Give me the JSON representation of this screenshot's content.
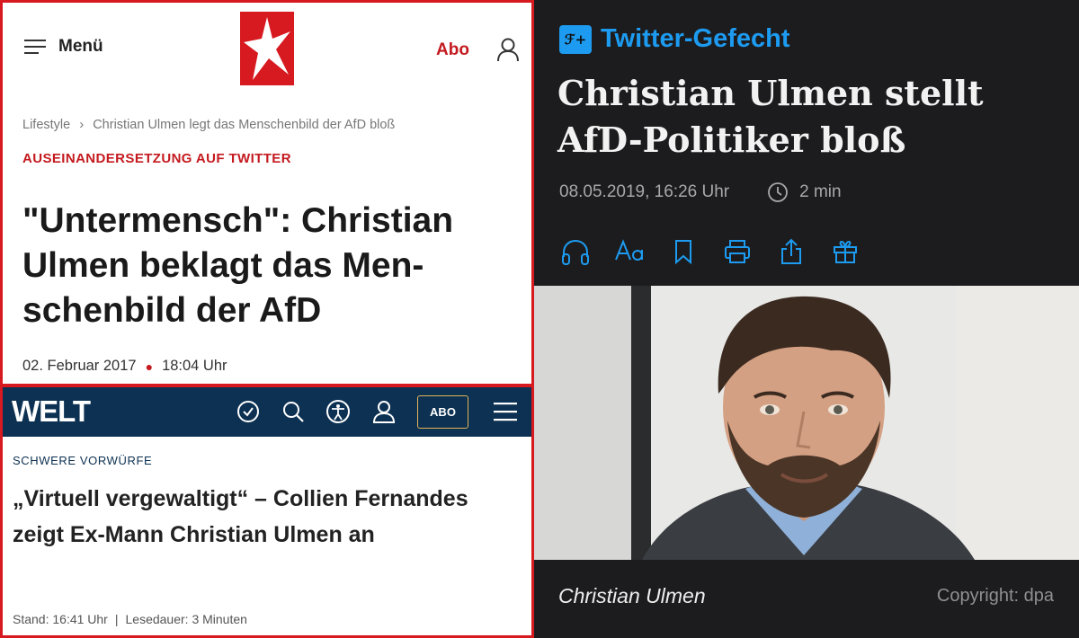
{
  "stern": {
    "menu_label": "Menü",
    "abo_label": "Abo",
    "breadcrumb": [
      "Lifestyle",
      "Christian Ulmen legt das Menschenbild der AfD bloß"
    ],
    "kicker": "AUSEINANDERSETZUNG AUF TWITTER",
    "headline": "\"Untermensch\": Christian Ulmen beklagt das Men-schenbild der AfD",
    "date": "02. Februar 2017",
    "time": "18:04 Uhr",
    "accent": "#d71920"
  },
  "welt": {
    "logo": "WELT",
    "abo_label": "ABO",
    "kicker": "SCHWERE VORWÜRFE",
    "headline": "„Virtuell vergewaltigt“ – Collien Fernandes zeigt Ex-Mann Christian Ulmen an",
    "stand": "Stand: 16:41 Uhr",
    "lesedauer": "Lesedauer: 3 Minuten",
    "nav_color": "#0d3152"
  },
  "right": {
    "badge": "ℱ+",
    "kicker": "Twitter-Gefecht",
    "headline": "Christian Ulmen stellt AfD-Politiker bloß",
    "date": "08.05.2019, 16:26 Uhr",
    "read_time": "2 min",
    "caption": "Christian Ulmen",
    "copyright": "Copyright: dpa",
    "accent": "#1d9bf0",
    "tools": [
      "headphones-icon",
      "font-size-icon",
      "bookmark-icon",
      "print-icon",
      "share-icon",
      "gift-icon"
    ]
  }
}
